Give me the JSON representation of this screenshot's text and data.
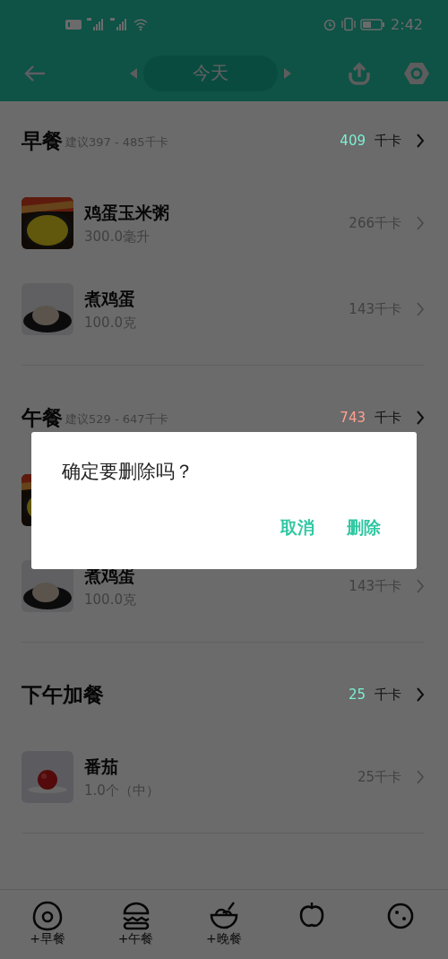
{
  "status_bar": {
    "time": "2:42"
  },
  "header": {
    "title": "今天"
  },
  "meals": [
    {
      "name": "早餐",
      "suggestion": "建议397 - 485千卡",
      "total": "409",
      "unit": "千卡",
      "color": "#7cf0d2",
      "items": [
        {
          "kind": "porridge",
          "name": "鸡蛋玉米粥",
          "amount": "300.0毫升",
          "calories": "266千卡"
        },
        {
          "kind": "egg",
          "name": "煮鸡蛋",
          "amount": "100.0克",
          "calories": "143千卡"
        }
      ]
    },
    {
      "name": "午餐",
      "suggestion": "建议529 - 647千卡",
      "total": "743",
      "unit": "千卡",
      "color": "#ffa090",
      "items": [
        {
          "kind": "covered"
        },
        {
          "kind": "egg",
          "name": "煮鸡蛋",
          "amount": "100.0克",
          "calories": "143千卡"
        }
      ]
    },
    {
      "name": "下午加餐",
      "total": "25",
      "unit": "千卡",
      "color": "#7cf0d2",
      "items": [
        {
          "kind": "tomato",
          "name": "番茄",
          "amount": "1.0个（中）",
          "calories": "25千卡"
        }
      ]
    }
  ],
  "dialog": {
    "message": "确定要删除吗？",
    "buttons": [
      "取消",
      "删除"
    ]
  },
  "bottom_nav": [
    {
      "kind": "egg",
      "label": "+早餐"
    },
    {
      "kind": "burger",
      "label": "+午餐"
    },
    {
      "kind": "bowl",
      "label": "+晚餐"
    },
    {
      "kind": "apple"
    },
    {
      "kind": "cookie"
    }
  ]
}
